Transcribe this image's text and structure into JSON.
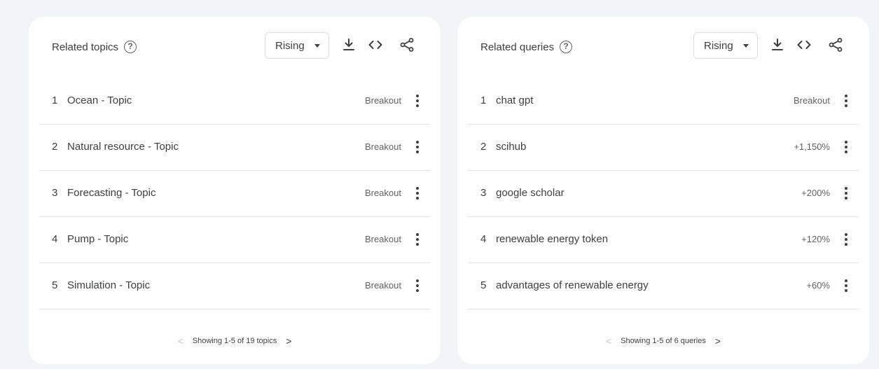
{
  "related_topics": {
    "title": "Related topics",
    "help_glyph": "?",
    "filter_value": "Rising",
    "rows": [
      {
        "rank": "1",
        "label": "Ocean - Topic",
        "value": "Breakout"
      },
      {
        "rank": "2",
        "label": "Natural resource - Topic",
        "value": "Breakout"
      },
      {
        "rank": "3",
        "label": "Forecasting - Topic",
        "value": "Breakout"
      },
      {
        "rank": "4",
        "label": "Pump - Topic",
        "value": "Breakout"
      },
      {
        "rank": "5",
        "label": "Simulation - Topic",
        "value": "Breakout"
      }
    ],
    "pager_text": "Showing 1-5 of 19 topics",
    "pager_prev": "<",
    "pager_next": ">"
  },
  "related_queries": {
    "title": "Related queries",
    "help_glyph": "?",
    "filter_value": "Rising",
    "rows": [
      {
        "rank": "1",
        "label": "chat gpt",
        "value": "Breakout"
      },
      {
        "rank": "2",
        "label": "scihub",
        "value": "+1,150%"
      },
      {
        "rank": "3",
        "label": "google scholar",
        "value": "+200%"
      },
      {
        "rank": "4",
        "label": "renewable energy token",
        "value": "+120%"
      },
      {
        "rank": "5",
        "label": "advantages of renewable energy",
        "value": "+60%"
      }
    ],
    "pager_text": "Showing 1-5 of 6 queries",
    "pager_prev": "<",
    "pager_next": ">"
  },
  "icons": {
    "help": "help-circle-icon",
    "dropdown": "caret-down-icon",
    "download": "download-icon",
    "embed": "code-embed-icon",
    "share": "share-icon",
    "more": "more-vert-icon",
    "prev": "chevron-left-icon",
    "next": "chevron-right-icon"
  },
  "colors": {
    "background": "#f1f4f9",
    "card": "#ffffff",
    "text": "#3c4043",
    "muted": "#5f6368",
    "divider": "#e3e3e3"
  }
}
